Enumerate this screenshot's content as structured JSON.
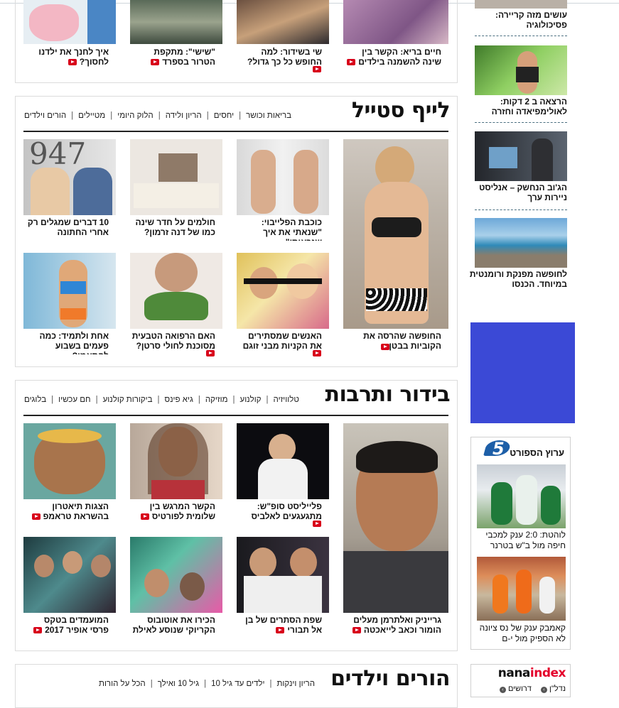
{
  "top_row": {
    "items": [
      {
        "caption": "חיים בריא: הקשר בין שינה להשמנה בילדים",
        "video": true
      },
      {
        "caption": "שי בשידור: למה החופש כל כך גדול?",
        "video": true
      },
      {
        "caption": "\"שישי\": מתקפת הטרור בספרד",
        "video": true
      },
      {
        "caption": "איך לחנך את ילדנו לחסוך?",
        "video": true
      }
    ]
  },
  "lifestyle": {
    "title": "לייף סטייל",
    "nav": [
      "בריאות וכושר",
      "יחסים",
      "הריון ולידה",
      "הלוק היומי",
      "מטיילים",
      "הורים וילדים"
    ],
    "feature": {
      "caption": "החופשה שהרסה את הקוביות בבטן",
      "video": true
    },
    "grid": [
      {
        "caption": "כוכבת הפלייבוי: \"שנאתי את איך שנראיתי\"",
        "video": false
      },
      {
        "caption": "חולמים על חדר שינה כמו של דנה זרמון?",
        "video": false
      },
      {
        "caption": "10 דברים שמגלים רק אחרי החתונה",
        "video": false
      },
      {
        "caption": "האנשים שמסתירים את הקניות מבני זוגם",
        "video": true
      },
      {
        "caption": "האם הרפואה הטבעית מסוכנת לחולי סרטן?",
        "video": true
      },
      {
        "caption": "אחת ולתמיד: כמה פעמים בשבוע להתאמן?",
        "video": true
      }
    ],
    "photo_text": "947"
  },
  "entertainment": {
    "title": "בידור ותרבות",
    "nav": [
      "טלוויזיה",
      "קולנוע",
      "מוזיקה",
      "גיא פינס",
      "ביקורות קולנוע",
      "חם עכשיו",
      "בלוגים"
    ],
    "feature": {
      "caption": "גרייניק ואלתרמן מעלים הומור וכאב לייאכטה",
      "video": true
    },
    "grid": [
      {
        "caption": "פלייליסט סופ\"ש: מתגעגעים לאלביס",
        "video": true
      },
      {
        "caption": "הקשר המרגש בין שלומית לפורטיס",
        "video": true
      },
      {
        "caption": "הצגות תיאטרון בהשראת טראמפ",
        "video": true
      },
      {
        "caption": "שפת הסתרים של בן אל תבורי",
        "video": true
      },
      {
        "caption": "הכירו את אוטובוס הקריוקי שנוסע לאילת",
        "video": true
      },
      {
        "caption": "המועמדים בטקס פרסי אופיר 2017",
        "video": true
      }
    ]
  },
  "parents": {
    "title": "הורים וילדים",
    "nav": [
      "הריון וינקות",
      "ילדים עד גיל 10",
      "גיל 10 ואילך",
      "הכל על הורות"
    ]
  },
  "sidebar": {
    "items": [
      {
        "caption": "עושים מזה קריירה: פסיכולוגיה"
      },
      {
        "caption": "הרצאה ב 2 דקות: לאולימפיאדה וחזרה"
      },
      {
        "caption": "הג'וב הנחשק – אנליסט ניירות ערך"
      },
      {
        "caption": "לחופשה מפנקת ורומנטית במיוחד. הכנסו"
      }
    ],
    "ad_color": "#3b49d6",
    "sport": {
      "logo_number": "5",
      "logo_text": "ערוץ הספורט",
      "items": [
        {
          "caption": "לוהטת: 2:0 ענק למכבי חיפה מול ב\"ש בטרנר"
        },
        {
          "caption": "קאמבק ענק של נס ציונה לא הספיק מול י-ם"
        }
      ]
    },
    "nana": {
      "logo_dark": "nana",
      "logo_accent": "index",
      "links": [
        "נדל\"ן",
        "דרושים"
      ]
    }
  },
  "colors": {
    "video_badge": "#d8001a",
    "nana_accent": "#e4002b",
    "sport_blue": "#1d5fa8"
  }
}
